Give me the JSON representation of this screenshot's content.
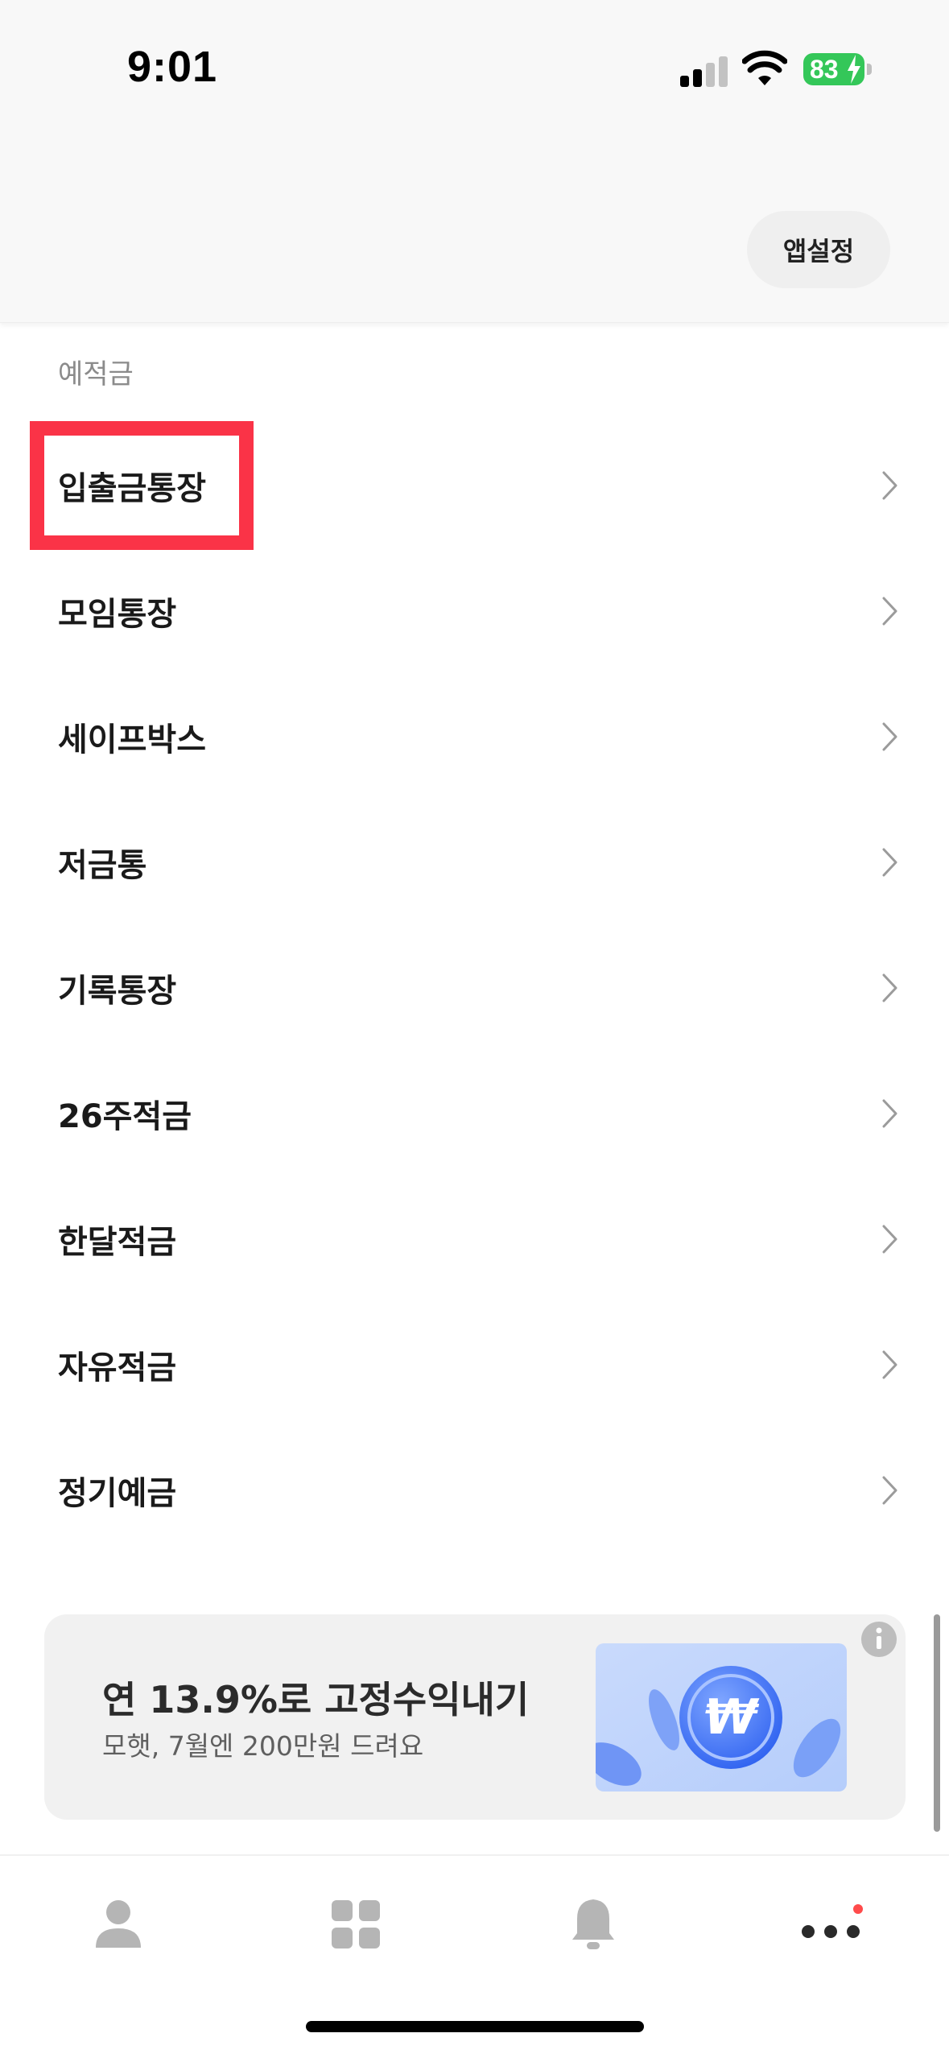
{
  "status_bar": {
    "time": "9:01",
    "battery": "83",
    "battery_color": "#34c759"
  },
  "header": {
    "app_settings_label": "앱설정"
  },
  "section": {
    "title": "예적금",
    "items": [
      {
        "label": "입출금통장",
        "icon": "chevron-right-icon",
        "highlighted": true
      },
      {
        "label": "모임통장",
        "icon": "chevron-right-icon"
      },
      {
        "label": "세이프박스",
        "icon": "chevron-right-icon"
      },
      {
        "label": "저금통",
        "icon": "chevron-right-icon"
      },
      {
        "label": "기록통장",
        "icon": "chevron-right-icon"
      },
      {
        "label": "26주적금",
        "icon": "chevron-right-icon"
      },
      {
        "label": "한달적금",
        "icon": "chevron-right-icon"
      },
      {
        "label": "자유적금",
        "icon": "chevron-right-icon"
      },
      {
        "label": "정기예금",
        "icon": "chevron-right-icon"
      }
    ]
  },
  "banner": {
    "title": "연 13.9%로 고정수익내기",
    "subtitle": "모햇, 7월엔 200만원 드려요",
    "image_icon": "won-coin-icon",
    "info_icon": "info-icon"
  },
  "tab_bar": {
    "tabs": [
      {
        "icon": "person-icon"
      },
      {
        "icon": "grid-icon"
      },
      {
        "icon": "bell-icon"
      },
      {
        "icon": "more-icon",
        "has_badge": true
      }
    ],
    "badge_color": "#ff4b4b"
  },
  "colors": {
    "highlight": "#fa3347",
    "icon_gray": "#b5b5b5",
    "banner_bg": "#f1f1f1"
  }
}
